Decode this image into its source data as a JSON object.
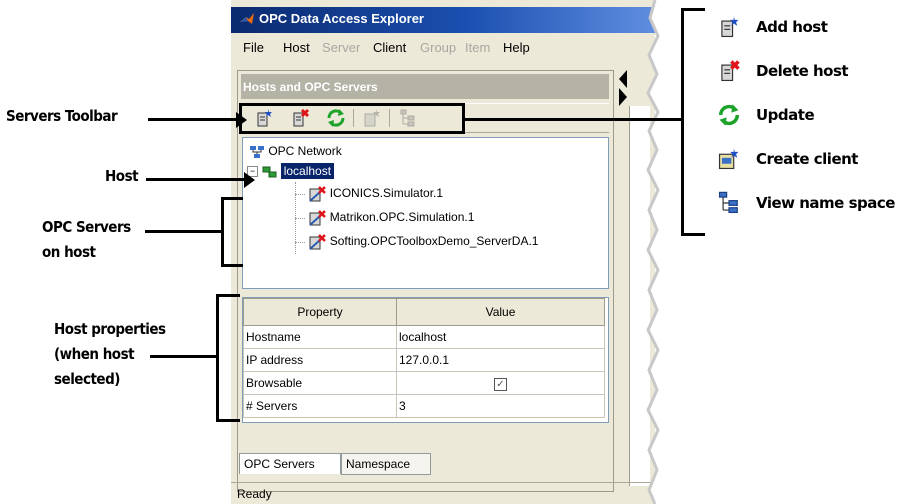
{
  "window": {
    "title": "OPC Data Access Explorer",
    "menu": [
      {
        "label": "File",
        "enabled": true
      },
      {
        "label": "Host",
        "enabled": true
      },
      {
        "label": "Server",
        "enabled": false
      },
      {
        "label": "Client",
        "enabled": true
      },
      {
        "label": "Group",
        "enabled": false
      },
      {
        "label": "Item",
        "enabled": false
      },
      {
        "label": "Help",
        "enabled": true
      }
    ],
    "panel_title": "Hosts and OPC Servers",
    "toolbar_icons": [
      "add-host-icon",
      "delete-host-icon",
      "update-icon",
      "create-client-icon",
      "view-namespace-icon"
    ],
    "tree": {
      "root": "OPC Network",
      "host": "localhost",
      "servers": [
        "ICONICS.Simulator.1",
        "Matrikon.OPC.Simulation.1",
        "Softing.OPCToolboxDemo_ServerDA.1"
      ]
    },
    "properties": {
      "headers": [
        "Property",
        "Value"
      ],
      "rows": [
        {
          "property": "Hostname",
          "value": "localhost"
        },
        {
          "property": "IP address",
          "value": "127.0.0.1"
        },
        {
          "property": "Browsable",
          "value": "",
          "checked": true
        },
        {
          "property": "# Servers",
          "value": "3"
        }
      ]
    },
    "tabs": [
      "OPC Servers",
      "Namespace"
    ],
    "status": "Ready",
    "colors": {
      "title_bar": "#0a2a6e",
      "selection": "#0a246a",
      "panel_bg": "#ece9d8"
    }
  },
  "callouts": {
    "servers_toolbar": "Servers Toolbar",
    "host": "Host",
    "opc_servers_line1": "OPC Servers",
    "opc_servers_line2": "on host",
    "host_props_line1": "Host properties",
    "host_props_line2": "(when host",
    "host_props_line3": "selected)"
  },
  "legend": [
    {
      "icon": "add-host-icon",
      "label": "Add host"
    },
    {
      "icon": "delete-host-icon",
      "label": "Delete host"
    },
    {
      "icon": "update-icon",
      "label": "Update"
    },
    {
      "icon": "create-client-icon",
      "label": "Create client"
    },
    {
      "icon": "view-namespace-icon",
      "label": "View name space"
    }
  ]
}
